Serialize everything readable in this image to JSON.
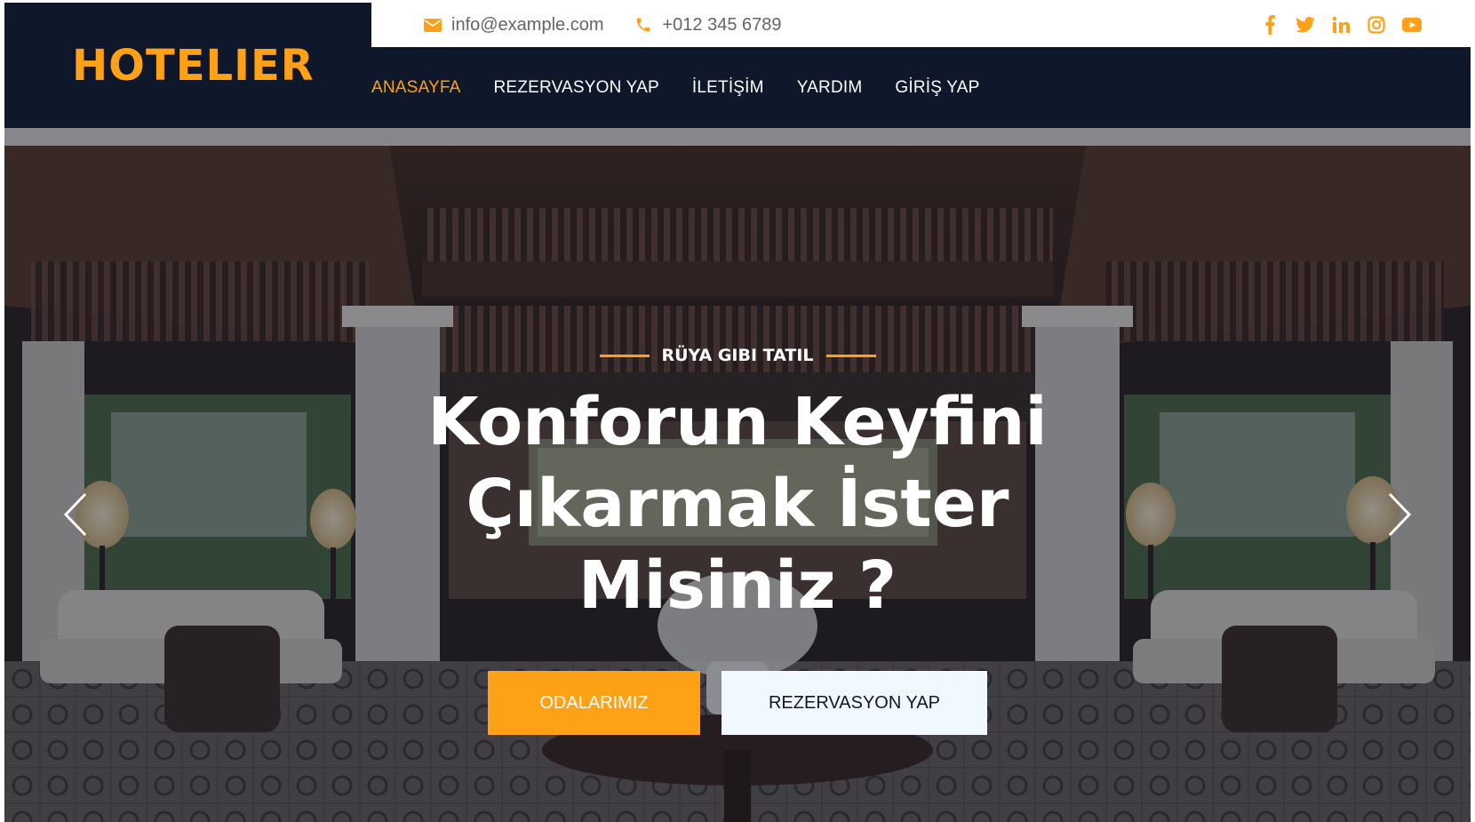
{
  "brand": {
    "name": "HOTELIER"
  },
  "topbar": {
    "email": "info@example.com",
    "phone": "+012 345 6789",
    "socials": [
      "facebook-icon",
      "twitter-icon",
      "linkedin-icon",
      "instagram-icon",
      "youtube-icon"
    ]
  },
  "nav": {
    "items": [
      {
        "label": "ANASAYFA",
        "active": true
      },
      {
        "label": "REZERVASYON YAP",
        "active": false
      },
      {
        "label": "İLETİŞİM",
        "active": false
      },
      {
        "label": "YARDIM",
        "active": false
      },
      {
        "label": "GİRİŞ YAP",
        "active": false
      }
    ]
  },
  "hero": {
    "subtitle": "RÜYA GIBI TATIL",
    "headline_line1": "Konforun Keyfini",
    "headline_line2": "Çıkarmak İster",
    "headline_line3": "Misiniz ?",
    "primary_button": "ODALARIMIZ",
    "secondary_button": "REZERVASYON YAP"
  },
  "colors": {
    "accent": "#fea116",
    "dark": "#0f172b",
    "light_button": "#f1f8ff"
  }
}
